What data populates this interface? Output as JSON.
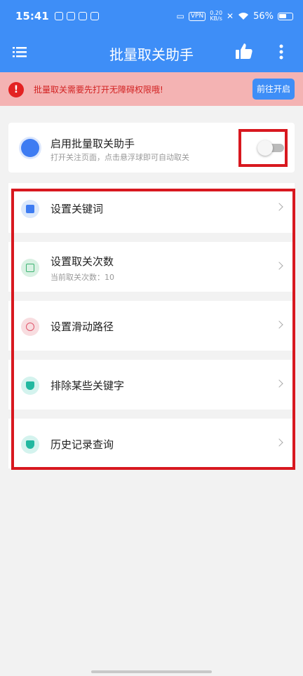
{
  "status_bar": {
    "time": "15:41",
    "vpn": "VPN",
    "speed_top": "0.20",
    "speed_bottom": "KB/s",
    "battery": "56%"
  },
  "app_bar": {
    "title": "批量取关助手",
    "menu_icon": "menu-icon",
    "like_icon": "thumb-up-icon",
    "more_icon": "more-vertical-icon"
  },
  "notice": {
    "text": "批量取关需要先打开无障碍权限哦!",
    "button": "前往开启",
    "icon": "alert-icon"
  },
  "enable_card": {
    "title": "启用批量取关助手",
    "subtitle": "打开关注页面，点击悬浮球即可自动取关",
    "toggle_on": false
  },
  "settings": [
    {
      "title": "设置关键词",
      "subtitle": "",
      "icon": "keyword-icon"
    },
    {
      "title": "设置取关次数",
      "subtitle": "当前取关次数：10",
      "icon": "count-icon"
    },
    {
      "title": "设置滑动路径",
      "subtitle": "",
      "icon": "swipe-path-icon"
    },
    {
      "title": "排除某些关键字",
      "subtitle": "",
      "icon": "shield-icon"
    },
    {
      "title": "历史记录查询",
      "subtitle": "",
      "icon": "history-shield-icon"
    }
  ],
  "colors": {
    "primary": "#3e8ef7",
    "notice_bg": "#f4b3b3",
    "notice_text": "#d22222",
    "highlight_border": "#d8181f"
  }
}
